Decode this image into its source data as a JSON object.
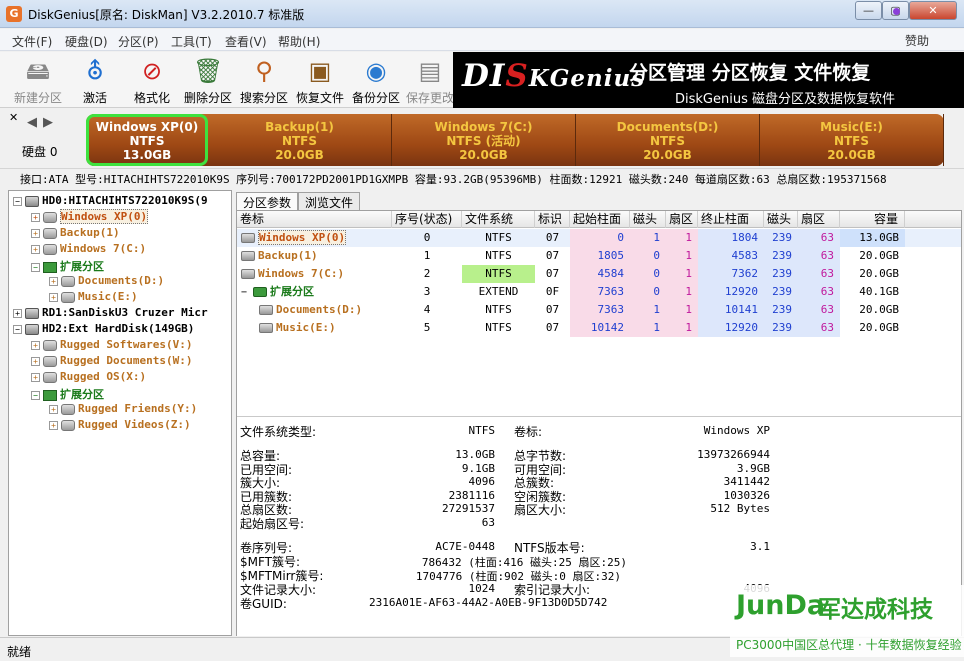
{
  "window": {
    "title": "DiskGenius[原名: DiskMan] V3.2.2010.7 标准版",
    "app_icon": "G",
    "min": "—",
    "max": "▢",
    "close": "✕"
  },
  "menu": [
    "文件(F)",
    "硬盘(D)",
    "分区(P)",
    "工具(T)",
    "查看(V)",
    "帮助(H)"
  ],
  "donate": "赞助",
  "toolbar": [
    {
      "label": "新建分区",
      "icon": "drive-icon",
      "glyph": "🖴",
      "enabled": false
    },
    {
      "label": "激活",
      "icon": "activate-icon",
      "glyph": "⛢",
      "enabled": true
    },
    {
      "label": "格式化",
      "icon": "format-icon",
      "glyph": "⊘",
      "enabled": true
    },
    {
      "label": "删除分区",
      "icon": "trash-icon",
      "glyph": "🗑",
      "enabled": true
    },
    {
      "label": "搜索分区",
      "icon": "magnifier-icon",
      "glyph": "⚲",
      "enabled": true
    },
    {
      "label": "恢复文件",
      "icon": "recover-box-icon",
      "glyph": "▣",
      "enabled": true
    },
    {
      "label": "备份分区",
      "icon": "backup-disc-icon",
      "glyph": "◉",
      "enabled": true
    },
    {
      "label": "保存更改",
      "icon": "save-icon",
      "glyph": "▤",
      "enabled": false
    }
  ],
  "banner": {
    "logo_pre": "DI",
    "logo_k": "S",
    "logo_post": "KGenius",
    "title": "分区管理 分区恢复 文件恢复",
    "subtitle": "DiskGenius 磁盘分区及数据恢复软件"
  },
  "diskmap": {
    "label": "硬盘 0",
    "segments": [
      {
        "name": "Windows XP(0)",
        "fs": "NTFS",
        "size": "13.0GB",
        "share": 13.0,
        "active": true
      },
      {
        "name": "Backup(1)",
        "fs": "NTFS",
        "size": "20.0GB",
        "share": 20.0,
        "active": false
      },
      {
        "name": "Windows 7(C:)",
        "fs": "NTFS (活动)",
        "size": "20.0GB",
        "share": 20.0,
        "active": false
      },
      {
        "name": "Documents(D:)",
        "fs": "NTFS",
        "size": "20.0GB",
        "share": 20.0,
        "active": false
      },
      {
        "name": "Music(E:)",
        "fs": "NTFS",
        "size": "20.0GB",
        "share": 20.0,
        "active": false
      }
    ]
  },
  "infoline": "接口:ATA  型号:HITACHIHTS722010K9S  序列号:700172PD2001PD1GXMPB  容量:93.2GB(95396MB)  柱面数:12921  磁头数:240  每道扇区数:63  总扇区数:195371568",
  "tree": [
    {
      "label": "HD0:HITACHIHTS722010K9S(9",
      "depth": 0,
      "exp": "−",
      "kind": "disk",
      "color": "dark"
    },
    {
      "label": "Windows XP(0)",
      "depth": 1,
      "exp": "+",
      "kind": "part",
      "color": "sel"
    },
    {
      "label": "Backup(1)",
      "depth": 1,
      "exp": "+",
      "kind": "part",
      "color": "orange"
    },
    {
      "label": "Windows 7(C:)",
      "depth": 1,
      "exp": "+",
      "kind": "part",
      "color": "orange"
    },
    {
      "label": "扩展分区",
      "depth": 1,
      "exp": "−",
      "kind": "ext",
      "color": "ext"
    },
    {
      "label": "Documents(D:)",
      "depth": 2,
      "exp": "+",
      "kind": "part",
      "color": "orange"
    },
    {
      "label": "Music(E:)",
      "depth": 2,
      "exp": "+",
      "kind": "part",
      "color": "orange"
    },
    {
      "label": "RD1:SanDiskU3 Cruzer Micr",
      "depth": 0,
      "exp": "+",
      "kind": "disk",
      "color": "dark"
    },
    {
      "label": "HD2:Ext HardDisk(149GB)",
      "depth": 0,
      "exp": "−",
      "kind": "disk",
      "color": "dark"
    },
    {
      "label": "Rugged Softwares(V:)",
      "depth": 1,
      "exp": "+",
      "kind": "part",
      "color": "orange"
    },
    {
      "label": "Rugged Documents(W:)",
      "depth": 1,
      "exp": "+",
      "kind": "part",
      "color": "orange"
    },
    {
      "label": "Rugged OS(X:)",
      "depth": 1,
      "exp": "+",
      "kind": "part",
      "color": "orange"
    },
    {
      "label": "扩展分区",
      "depth": 1,
      "exp": "−",
      "kind": "ext",
      "color": "ext"
    },
    {
      "label": "Rugged Friends(Y:)",
      "depth": 2,
      "exp": "+",
      "kind": "part",
      "color": "orange"
    },
    {
      "label": "Rugged Videos(Z:)",
      "depth": 2,
      "exp": "+",
      "kind": "part",
      "color": "orange"
    }
  ],
  "tabs": [
    "分区参数",
    "浏览文件"
  ],
  "table": {
    "headers": [
      "卷标",
      "序号(状态)",
      "文件系统",
      "标识",
      "起始柱面",
      "磁头",
      "扇区",
      "终止柱面",
      "磁头",
      "扇区",
      "容量"
    ],
    "rows": [
      {
        "label": "Windows XP(0)",
        "indent": 0,
        "kind": "part",
        "cells": [
          "0",
          "NTFS",
          "07",
          "0",
          "1",
          "1",
          "1804",
          "239",
          "63",
          "13.0GB"
        ],
        "selected": true
      },
      {
        "label": "Backup(1)",
        "indent": 0,
        "kind": "part",
        "cells": [
          "1",
          "NTFS",
          "07",
          "1805",
          "0",
          "1",
          "4583",
          "239",
          "63",
          "20.0GB"
        ]
      },
      {
        "label": "Windows 7(C:)",
        "indent": 0,
        "kind": "part",
        "cells": [
          "2",
          "NTFS",
          "07",
          "4584",
          "0",
          "1",
          "7362",
          "239",
          "63",
          "20.0GB"
        ],
        "fs_highlight": true
      },
      {
        "label": "扩展分区",
        "indent": 0,
        "kind": "ext",
        "cells": [
          "3",
          "EXTEND",
          "0F",
          "7363",
          "0",
          "1",
          "12920",
          "239",
          "63",
          "40.1GB"
        ]
      },
      {
        "label": "Documents(D:)",
        "indent": 1,
        "kind": "part",
        "cells": [
          "4",
          "NTFS",
          "07",
          "7363",
          "1",
          "1",
          "10141",
          "239",
          "63",
          "20.0GB"
        ]
      },
      {
        "label": "Music(E:)",
        "indent": 1,
        "kind": "part",
        "cells": [
          "5",
          "NTFS",
          "07",
          "10142",
          "1",
          "1",
          "12920",
          "239",
          "63",
          "20.0GB"
        ]
      }
    ]
  },
  "details": {
    "fs_type_label": "文件系统类型:",
    "fs_type": "NTFS",
    "vol_label_label": "卷标:",
    "vol_label": "Windows XP",
    "left": [
      [
        "总容量:",
        "13.0GB"
      ],
      [
        "已用空间:",
        "9.1GB"
      ],
      [
        "簇大小:",
        "4096"
      ],
      [
        "已用簇数:",
        "2381116"
      ],
      [
        "总扇区数:",
        "27291537"
      ],
      [
        "起始扇区号:",
        "63"
      ]
    ],
    "right": [
      [
        "总字节数:",
        "13973266944"
      ],
      [
        "可用空间:",
        "3.9GB"
      ],
      [
        "总簇数:",
        "3411442"
      ],
      [
        "空闲簇数:",
        "1030326"
      ],
      [
        "扇区大小:",
        "512 Bytes"
      ]
    ],
    "serial_label": "卷序列号:",
    "serial": "AC7E-0448",
    "ntfs_ver_label": "NTFS版本号:",
    "ntfs_ver": "3.1",
    "mft_label": "$MFT簇号:",
    "mft": "786432 (柱面:416 磁头:25 扇区:25)",
    "mftmirr_label": "$MFTMirr簇号:",
    "mftmirr": "1704776 (柱面:902 磁头:0 扇区:32)",
    "rec_label": "文件记录大小:",
    "rec": "1024",
    "idx_label": "索引记录大小:",
    "idx": "4096",
    "guid_label": "卷GUID:",
    "guid": "2316A01E-AF63-44A2-A0EB-9F13D0D5D742"
  },
  "status": "就绪",
  "watermark": {
    "logo": "JunDa",
    "cn": "军达成科技",
    "sub": "PC3000中国区总代理 · 十年数据恢复经验"
  },
  "colors": {
    "selected_text": "#c05010",
    "partition_text": "#b87020",
    "extended": "#1a7a1a",
    "active_border": "#3ee23e"
  }
}
